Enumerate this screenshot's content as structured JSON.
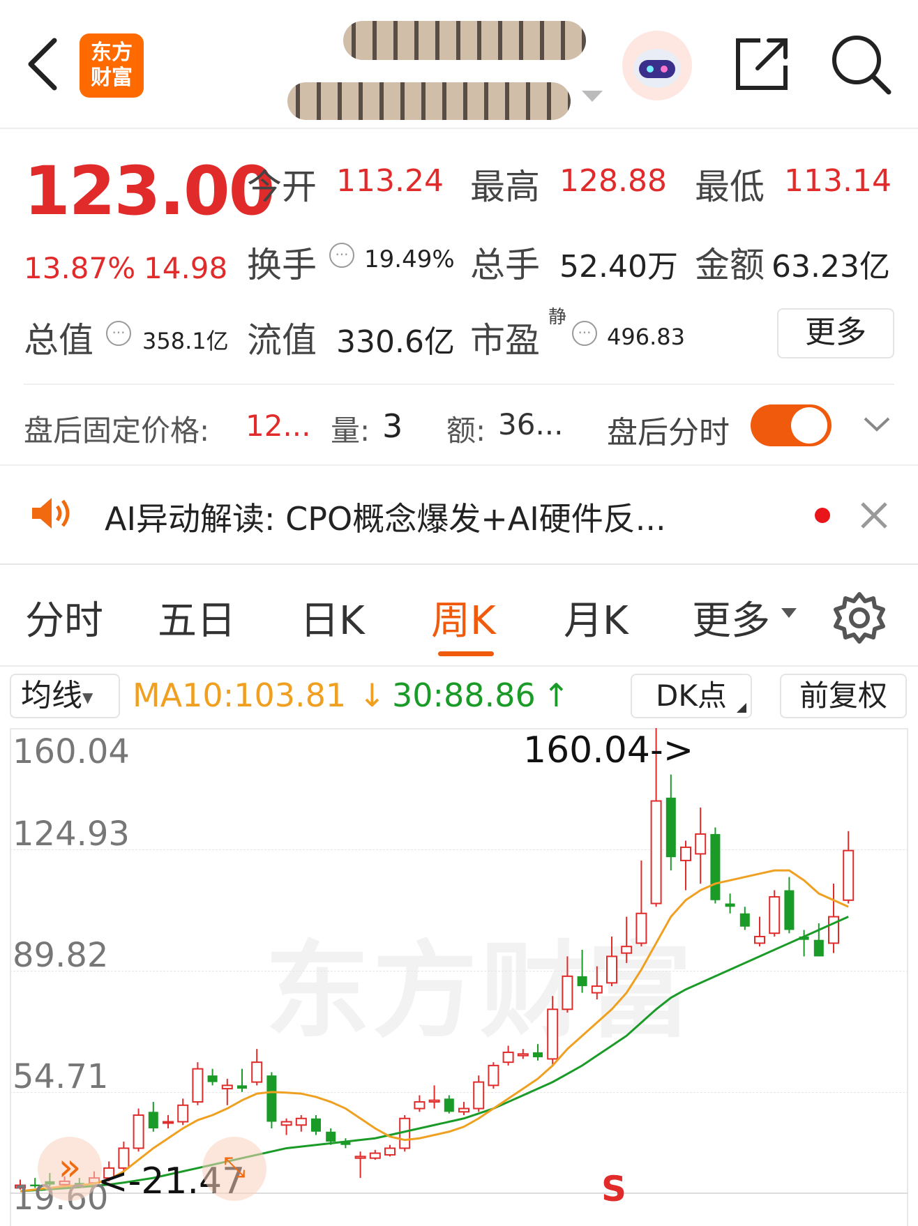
{
  "header": {
    "brand": "东方\n财富",
    "back_icon": "chevron-left-icon",
    "share_icon": "share-icon",
    "search_icon": "search-icon",
    "assistant_icon": "robot-avatar-icon"
  },
  "quote": {
    "price": "123.00",
    "change_pct": "13.87%",
    "change": "14.98",
    "open_label": "今开",
    "open": "113.24",
    "high_label": "最高",
    "high": "128.88",
    "low_label": "最低",
    "low": "113.14",
    "turnover_label": "换手",
    "turnover": "19.49%",
    "volume_label": "总手",
    "volume": "52.40万",
    "amount_label": "金额",
    "amount": "63.23亿",
    "mcap_label": "总值",
    "mcap": "358.1亿",
    "float_label": "流值",
    "float": "330.6亿",
    "pe_label": "市盈",
    "pe_sup": "静",
    "pe": "496.83",
    "more_button": "更多"
  },
  "after_hours": {
    "price_label": "盘后固定价格:",
    "price": "12...",
    "qty_label": "量:",
    "qty": "3",
    "amt_label": "额:",
    "amt": "36...",
    "toggle_label": "盘后分时",
    "toggle_on": true
  },
  "ai_banner": {
    "text": "AI异动解读:  CPO概念爆发+AI硬件反..."
  },
  "tabs": [
    "分时",
    "五日",
    "日K",
    "周K",
    "月K",
    "更多"
  ],
  "active_tab": "周K",
  "indicator_bar": {
    "ma_select": "均线",
    "ma10": "MA10:103.81",
    "ma10_arrow": "↓",
    "ma30": "30:88.86",
    "ma30_arrow": "↑",
    "dk_button": "DK点",
    "adjust_button": "前复权"
  },
  "colors": {
    "up": "#e12b2b",
    "down": "#1a9b28",
    "accent": "#f05a0c",
    "ma10": "#f0a020",
    "ma30": "#1a9b28"
  },
  "chart_data": {
    "type": "candlestick",
    "y_ticks": [
      "160.04",
      "124.93",
      "89.82",
      "54.71",
      "19.60"
    ],
    "ylim": [
      19.6,
      160.04
    ],
    "max_label": "160.04->",
    "min_label": "<-21.47",
    "signal": "S",
    "watermark": "东方财富",
    "candles": [
      {
        "o": 21.0,
        "c": 21.8,
        "h": 23.5,
        "l": 20.5
      },
      {
        "o": 22.0,
        "c": 21.5,
        "h": 24.0,
        "l": 21.0
      },
      {
        "o": 23.0,
        "c": 22.0,
        "h": 25.5,
        "l": 21.5
      },
      {
        "o": 22.0,
        "c": 23.0,
        "h": 24.5,
        "l": 21.5
      },
      {
        "o": 22.5,
        "c": 22.0,
        "h": 24.0,
        "l": 21.47
      },
      {
        "o": 22.5,
        "c": 24.0,
        "h": 26.0,
        "l": 22.0
      },
      {
        "o": 24.0,
        "c": 27.0,
        "h": 29.0,
        "l": 23.0
      },
      {
        "o": 27.0,
        "c": 33.0,
        "h": 35.0,
        "l": 26.0
      },
      {
        "o": 33.0,
        "c": 43.0,
        "h": 45.0,
        "l": 32.0
      },
      {
        "o": 44.0,
        "c": 39.0,
        "h": 47.0,
        "l": 38.0
      },
      {
        "o": 41.0,
        "c": 41.0,
        "h": 43.0,
        "l": 39.0
      },
      {
        "o": 41.0,
        "c": 46.0,
        "h": 48.0,
        "l": 40.0
      },
      {
        "o": 47.0,
        "c": 57.0,
        "h": 59.0,
        "l": 46.0
      },
      {
        "o": 55.0,
        "c": 53.0,
        "h": 57.0,
        "l": 52.0
      },
      {
        "o": 51.0,
        "c": 52.0,
        "h": 54.0,
        "l": 46.0
      },
      {
        "o": 52.0,
        "c": 51.0,
        "h": 57.0,
        "l": 50.0
      },
      {
        "o": 53.0,
        "c": 59.0,
        "h": 63.0,
        "l": 52.0
      },
      {
        "o": 55.0,
        "c": 41.0,
        "h": 56.0,
        "l": 39.0
      },
      {
        "o": 40.0,
        "c": 41.0,
        "h": 42.0,
        "l": 37.0
      },
      {
        "o": 40.0,
        "c": 42.0,
        "h": 43.0,
        "l": 38.0
      },
      {
        "o": 42.0,
        "c": 38.0,
        "h": 43.0,
        "l": 37.0
      },
      {
        "o": 38.0,
        "c": 35.0,
        "h": 39.0,
        "l": 34.0
      },
      {
        "o": 35.0,
        "c": 34.0,
        "h": 36.0,
        "l": 33.0
      },
      {
        "o": 30.0,
        "c": 30.5,
        "h": 32.0,
        "l": 24.0
      },
      {
        "o": 30.0,
        "c": 31.5,
        "h": 32.5,
        "l": 29.5
      },
      {
        "o": 31.0,
        "c": 33.0,
        "h": 34.0,
        "l": 30.5
      },
      {
        "o": 33.0,
        "c": 42.0,
        "h": 43.0,
        "l": 32.0
      },
      {
        "o": 45.0,
        "c": 47.0,
        "h": 49.0,
        "l": 44.0
      },
      {
        "o": 47.0,
        "c": 47.5,
        "h": 52.0,
        "l": 45.0
      },
      {
        "o": 48.0,
        "c": 44.0,
        "h": 49.0,
        "l": 43.5
      },
      {
        "o": 44.0,
        "c": 45.0,
        "h": 47.0,
        "l": 43.0
      },
      {
        "o": 45.0,
        "c": 53.0,
        "h": 55.0,
        "l": 44.0
      },
      {
        "o": 52.0,
        "c": 58.0,
        "h": 59.0,
        "l": 51.0
      },
      {
        "o": 59.0,
        "c": 62.0,
        "h": 64.0,
        "l": 58.0
      },
      {
        "o": 61.0,
        "c": 61.5,
        "h": 63.0,
        "l": 60.0
      },
      {
        "o": 62.0,
        "c": 60.5,
        "h": 64.5,
        "l": 59.5
      },
      {
        "o": 60.0,
        "c": 75.0,
        "h": 79.0,
        "l": 58.0
      },
      {
        "o": 75.0,
        "c": 85.0,
        "h": 91.0,
        "l": 74.0
      },
      {
        "o": 85.0,
        "c": 82.0,
        "h": 93.0,
        "l": 80.0
      },
      {
        "o": 80.0,
        "c": 82.0,
        "h": 88.0,
        "l": 78.0
      },
      {
        "o": 83.0,
        "c": 91.0,
        "h": 97.0,
        "l": 82.0
      },
      {
        "o": 92.0,
        "c": 94.0,
        "h": 103.0,
        "l": 89.0
      },
      {
        "o": 95.0,
        "c": 104.0,
        "h": 120.0,
        "l": 94.0
      },
      {
        "o": 107.0,
        "c": 138.0,
        "h": 160.04,
        "l": 106.0
      },
      {
        "o": 139.0,
        "c": 121.0,
        "h": 146.0,
        "l": 117.0
      },
      {
        "o": 120.0,
        "c": 124.0,
        "h": 126.0,
        "l": 111.0
      },
      {
        "o": 122.0,
        "c": 128.0,
        "h": 136.0,
        "l": 113.0
      },
      {
        "o": 128.0,
        "c": 108.0,
        "h": 130.0,
        "l": 107.0
      },
      {
        "o": 107.0,
        "c": 106.0,
        "h": 110.0,
        "l": 104.0
      },
      {
        "o": 104.0,
        "c": 100.0,
        "h": 106.0,
        "l": 99.0
      },
      {
        "o": 95.0,
        "c": 97.0,
        "h": 103.0,
        "l": 94.0
      },
      {
        "o": 98.0,
        "c": 109.0,
        "h": 111.0,
        "l": 97.0
      },
      {
        "o": 111.0,
        "c": 99.0,
        "h": 115.0,
        "l": 98.0
      },
      {
        "o": 97.0,
        "c": 96.0,
        "h": 99.0,
        "l": 91.0
      },
      {
        "o": 96.0,
        "c": 91.0,
        "h": 101.0,
        "l": 91.0
      },
      {
        "o": 95.0,
        "c": 103.0,
        "h": 113.0,
        "l": 92.0
      },
      {
        "o": 108.0,
        "c": 123.0,
        "h": 128.88,
        "l": 107.0
      }
    ],
    "ma10": [
      20,
      20.5,
      21,
      21.5,
      21.8,
      22.3,
      23.5,
      26,
      29.5,
      33,
      36,
      39,
      41.5,
      43,
      45,
      47.5,
      49.5,
      50,
      49.8,
      49.5,
      48.5,
      47,
      45,
      42,
      39,
      36.5,
      35.5,
      36,
      37,
      38,
      39.5,
      42,
      45,
      48,
      51,
      54,
      58,
      63,
      67,
      71,
      75,
      80,
      87,
      95,
      103,
      108,
      111,
      113,
      114,
      115,
      116,
      117,
      117,
      114,
      110,
      108,
      106
    ],
    "ma30": [
      20,
      20.3,
      20.6,
      20.9,
      21.2,
      21.6,
      22,
      22.6,
      23.3,
      24,
      25,
      26,
      27,
      28,
      29,
      30,
      31,
      32,
      33,
      33.5,
      34,
      34.5,
      35,
      35.5,
      36,
      37,
      38,
      39,
      40,
      41,
      42,
      43.5,
      45,
      47,
      49,
      51,
      53,
      55.5,
      58,
      61,
      64,
      67,
      71,
      75,
      78.5,
      81,
      83,
      85,
      87,
      89,
      91,
      93,
      95,
      97,
      99,
      101,
      103
    ]
  }
}
